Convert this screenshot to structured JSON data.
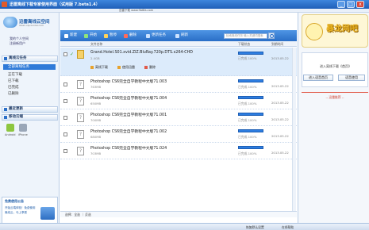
{
  "window": {
    "title": "迅雷离线下载专家使用界面（试用版 7.beta1.4）",
    "url": "迅雷下载 www.9b6fa.com",
    "minimize": "_",
    "maximize": "□",
    "close": "x"
  },
  "sidebar": {
    "brand": "迅雷离线云空间",
    "brand_sub": "lixian.vip.xunlei.com",
    "login": "我的个人空间",
    "register": "注册新用户",
    "section_tasks": "离线云任务",
    "items": [
      "全部离线任务",
      "正在下载",
      "已下载",
      "已完成",
      "已删除"
    ],
    "section_tools": "最近更新",
    "section_devices": "移动云端",
    "devices": [
      "Android",
      "iPhone"
    ],
    "notice_title": "免费使用公告",
    "notice_body": "开始云端体验！免费使用离线云，马上享受"
  },
  "toolbar": {
    "buttons": [
      "新建",
      "开始",
      "暂停",
      "删除",
      "更新任务",
      "刷新"
    ],
    "search_placeholder": "检索离线任务 输入关键词搜索"
  },
  "columns": {
    "name": "文件名称",
    "status": "下载状态",
    "date": "到期时间"
  },
  "tasks": [
    {
      "name": "Grand.Hotel.S01.xvid.ZlZ.BluRay.720p.DTS.x264-CHD",
      "size": "2.4GB",
      "status": "已完成 100%",
      "date": "2013.05.22",
      "progress": 1.0,
      "selected": true,
      "actions": [
        "离线下载",
        "使用迅雷",
        "删除"
      ]
    },
    {
      "name": "Photoshop CS6完全自学教程中文版71.003",
      "size": "763MB",
      "status": "已完成 100%",
      "date": "2013.05.22",
      "progress": 1.0,
      "selected": false
    },
    {
      "name": "Photoshop CS6完全自学教程中文版71.004",
      "size": "650MB",
      "status": "已完成 100%",
      "date": "2013.05.22",
      "progress": 1.0,
      "selected": false
    },
    {
      "name": "Photoshop CS6完全自学教程中文版71.001",
      "size": "700MB",
      "status": "已完成 100%",
      "date": "2013.05.22",
      "progress": 1.0,
      "selected": false
    },
    {
      "name": "Photoshop CS6完全自学教程中文版71.002",
      "size": "680MB",
      "status": "已完成 100%",
      "date": "2013.05.22",
      "progress": 1.0,
      "selected": false
    },
    {
      "name": "Photoshop CS6完全自学教程中文版71.024",
      "size": "703MB",
      "status": "已完成 100%",
      "date": "2013.05.22",
      "progress": 1.0,
      "selected": false
    }
  ],
  "bottom": {
    "selection": "选择：全选 ｜ 反选"
  },
  "statusbar": {
    "left": "",
    "right1": "恢复默认设置",
    "right2": "在线帮助"
  },
  "rpanel": {
    "logo_text": "暴龙网吧",
    "promo_text": "进入离线下载《首页》",
    "btn_download": "进入语音首页",
    "btn_help": "语音使用",
    "tip": "-- 迅雷推荐 --"
  },
  "colors": {
    "accent": "#2a6ec7",
    "progress": "#2d7de0",
    "selected_row": "#dcebfb"
  }
}
